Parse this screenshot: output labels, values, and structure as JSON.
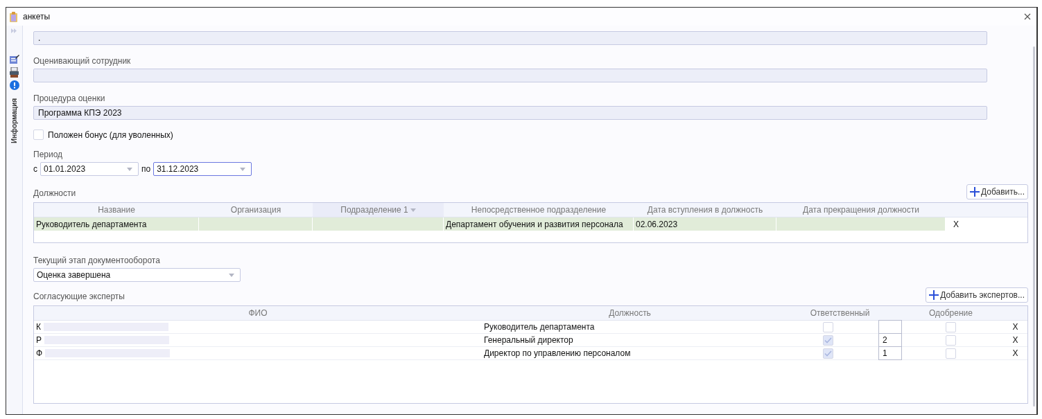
{
  "window": {
    "title": "анкеты"
  },
  "sidebar": {
    "tab_label": "Информация"
  },
  "fields": [
    {
      "value": "."
    },
    {
      "label": "Оценивающий сотрудник"
    },
    {
      "label": "Процедура оценки",
      "value": "Программа КПЭ 2023"
    }
  ],
  "bonus_checkbox": {
    "label": "Положен бонус (для уволенных)",
    "checked": false
  },
  "period": {
    "label": "Период",
    "from_label": "с",
    "from": "01.01.2023",
    "to_label": "по",
    "to": "31.12.2023",
    "to_focused": true
  },
  "positions": {
    "label": "Должности",
    "add_button": "Добавить...",
    "columns": [
      {
        "label": "Название",
        "sorted": false
      },
      {
        "label": "Организация",
        "sorted": false
      },
      {
        "label": "Подразделение 1",
        "sorted": true
      },
      {
        "label": "Непосредственное подразделение",
        "sorted": false
      },
      {
        "label": "Дата вступления в должность",
        "sorted": false
      },
      {
        "label": "Дата прекращения должности",
        "sorted": false
      }
    ],
    "rows": [
      {
        "cells": [
          "Руководитель департамента",
          "",
          "",
          "Департамент обучения и развития персонала",
          "02.06.2023",
          ""
        ],
        "delete": "X"
      }
    ]
  },
  "workflow_stage": {
    "label": "Текущий этап документооборота",
    "value": "Оценка завершена"
  },
  "experts": {
    "label": "Согласующие эксперты",
    "add_button": "Добавить экспертов...",
    "columns": [
      "ФИО",
      "Должность",
      "Ответственный",
      "Одобрение"
    ],
    "rows": [
      {
        "name": "К",
        "position": "Руководитель департамента",
        "responsible": false,
        "approved": false,
        "delete": "X"
      },
      {
        "name": "Р",
        "position": "Генеральный директор",
        "responsible": true,
        "order": "2",
        "approved": false,
        "delete": "X"
      },
      {
        "name": "Ф",
        "position": "Директор по управлению персоналом",
        "responsible": true,
        "order": "1",
        "approved": false,
        "delete": "X"
      }
    ]
  }
}
